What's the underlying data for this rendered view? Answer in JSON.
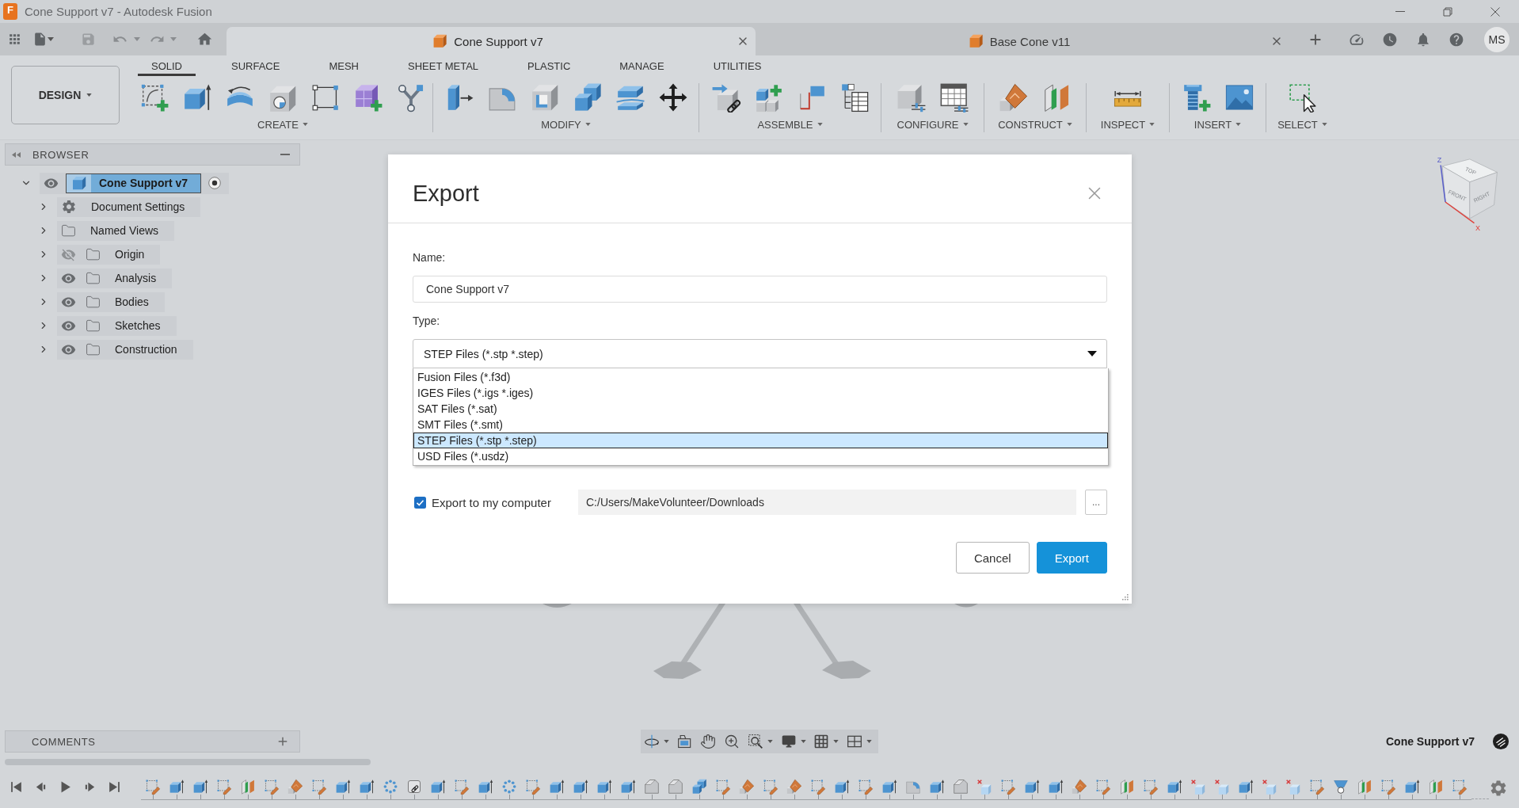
{
  "window": {
    "title": "Cone Support v7 - Autodesk Fusion",
    "icon_letter": "F"
  },
  "document_tabs": [
    {
      "label": "Cone Support v7",
      "selected": true
    },
    {
      "label": "Base Cone v11",
      "selected": false
    }
  ],
  "user": {
    "initials": "MS"
  },
  "workspace_menu": {
    "label": "DESIGN"
  },
  "toolbar_tabs": [
    {
      "label": "SOLID",
      "selected": true
    },
    {
      "label": "SURFACE",
      "selected": false
    },
    {
      "label": "MESH",
      "selected": false
    },
    {
      "label": "SHEET METAL",
      "selected": false
    },
    {
      "label": "PLASTIC",
      "selected": false
    },
    {
      "label": "MANAGE",
      "selected": false
    },
    {
      "label": "UTILITIES",
      "selected": false
    }
  ],
  "tool_groups": [
    {
      "label": "CREATE"
    },
    {
      "label": "MODIFY"
    },
    {
      "label": "ASSEMBLE"
    },
    {
      "label": "CONFIGURE"
    },
    {
      "label": "CONSTRUCT"
    },
    {
      "label": "INSPECT"
    },
    {
      "label": "INSERT"
    },
    {
      "label": "SELECT"
    }
  ],
  "browser": {
    "title": "BROWSER",
    "tree": [
      {
        "label": "Cone Support v7",
        "kind": "component",
        "expanded": true,
        "visible": true,
        "active": true,
        "children": [
          {
            "label": "Document Settings",
            "kind": "settings",
            "expanded": false
          },
          {
            "label": "Named Views",
            "kind": "views",
            "expanded": false
          },
          {
            "label": "Origin",
            "kind": "folder",
            "expanded": false,
            "visible": false
          },
          {
            "label": "Analysis",
            "kind": "folder",
            "expanded": false,
            "visible": true
          },
          {
            "label": "Bodies",
            "kind": "folder",
            "expanded": false,
            "visible": true
          },
          {
            "label": "Sketches",
            "kind": "folder",
            "expanded": false,
            "visible": true
          },
          {
            "label": "Construction",
            "kind": "folder",
            "expanded": false,
            "visible": true
          }
        ]
      }
    ]
  },
  "viewcube": {
    "faces": [
      "TOP",
      "FRONT",
      "RIGHT"
    ],
    "axes": [
      {
        "label": "Z",
        "color": "#5a5fc8"
      },
      {
        "label": "X",
        "color": "#e0403a"
      }
    ]
  },
  "export_dialog": {
    "title": "Export",
    "name_label": "Name:",
    "name_value": "Cone Support v7",
    "type_label": "Type:",
    "type_select": {
      "value": "STEP Files (*.stp *.step)",
      "expanded": true,
      "options": [
        {
          "label": "Fusion Files (*.f3d)",
          "selected": false
        },
        {
          "label": "IGES Files (*.igs *.iges)",
          "selected": false
        },
        {
          "label": "SAT Files (*.sat)",
          "selected": false
        },
        {
          "label": "SMT Files (*.smt)",
          "selected": false
        },
        {
          "label": "STEP Files (*.stp *.step)",
          "selected": true
        },
        {
          "label": "USD Files (*.usdz)",
          "selected": false
        }
      ]
    },
    "export_to_computer": {
      "label": "Export to my computer",
      "checked": true
    },
    "folder_path": "C:/Users/MakeVolunteer/Downloads",
    "browse_button": "...",
    "buttons": [
      {
        "label": "Cancel",
        "kind": "secondary"
      },
      {
        "label": "Export",
        "kind": "primary"
      }
    ]
  },
  "comments": {
    "title": "COMMENTS"
  },
  "status": {
    "document_name": "Cone Support v7"
  }
}
